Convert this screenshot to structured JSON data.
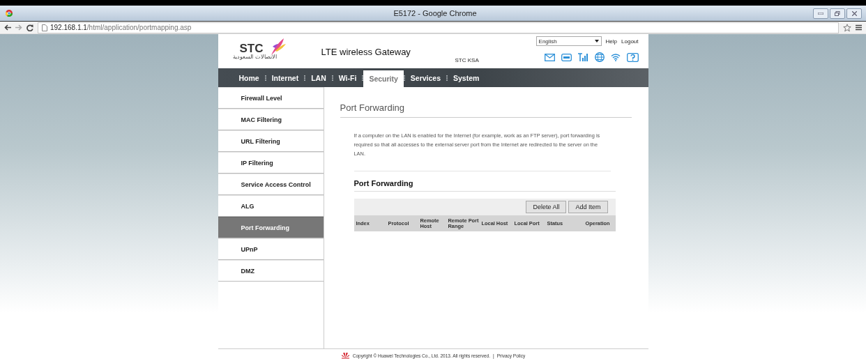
{
  "window": {
    "title": "E5172 - Google Chrome"
  },
  "address_bar": {
    "host": "192.168.1.1",
    "path": "/html/application/portmapping.asp"
  },
  "header": {
    "logo_text": "STC",
    "logo_subtext": "الاتصالات السعودية",
    "product": "LTE wireless Gateway",
    "operator": "STC KSA",
    "language": "English",
    "links": [
      "Help",
      "Logout"
    ]
  },
  "nav": [
    {
      "label": "Home",
      "selected": false
    },
    {
      "label": "Internet",
      "selected": false
    },
    {
      "label": "LAN",
      "selected": false
    },
    {
      "label": "Wi-Fi",
      "selected": false
    },
    {
      "label": "Security",
      "selected": true
    },
    {
      "label": "Services",
      "selected": false
    },
    {
      "label": "System",
      "selected": false
    }
  ],
  "sidebar": {
    "items": [
      {
        "label": "Firewall Level",
        "selected": false
      },
      {
        "label": "MAC Filtering",
        "selected": false
      },
      {
        "label": "URL Filtering",
        "selected": false
      },
      {
        "label": "IP Filtering",
        "selected": false
      },
      {
        "label": "Service Access Control",
        "selected": false
      },
      {
        "label": "ALG",
        "selected": false
      },
      {
        "label": "Port Forwarding",
        "selected": true
      },
      {
        "label": "UPnP",
        "selected": false
      },
      {
        "label": "DMZ",
        "selected": false
      }
    ]
  },
  "content": {
    "title": "Port Forwarding",
    "description": "If a computer on the LAN is enabled for the Internet (for example, work as an FTP server), port forwarding is required so that all accesses to the external server port from the Internet are redirected to the server on the LAN.",
    "section_title": "Port Forwarding",
    "buttons": [
      "Delete All",
      "Add Item"
    ],
    "table": {
      "columns": [
        "Index",
        "Protocol",
        "Remote Host",
        "Remote Port Range",
        "Local Host",
        "Local Port",
        "Status",
        "Operation"
      ]
    }
  },
  "footer": {
    "copyright": "Copyright © Huawei Technologies Co., Ltd. 2013. All rights reserved.",
    "separator": "|",
    "link": "Privacy Policy"
  }
}
